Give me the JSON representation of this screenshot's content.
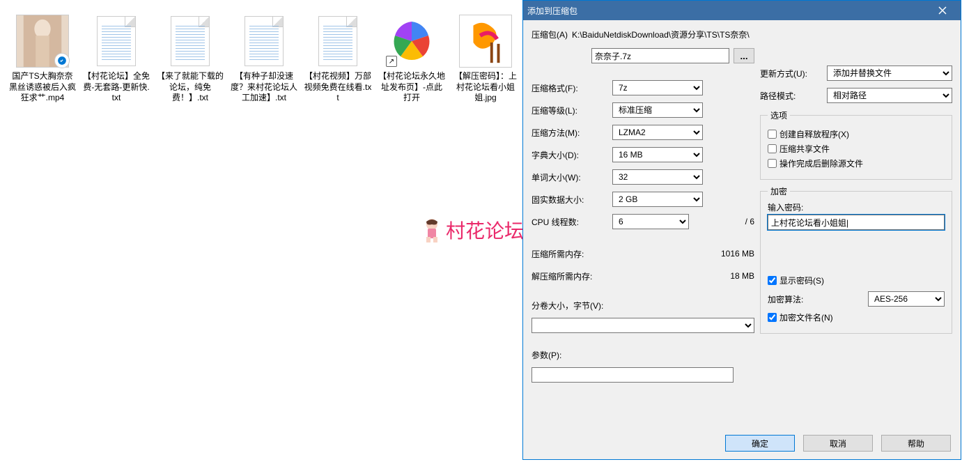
{
  "files": [
    {
      "label": "国产TS大胸奈奈黑丝诱惑被后入疯狂求艹.mp4",
      "type": "img"
    },
    {
      "label": "【村花论坛】全免费-无套路-更新快.txt",
      "type": "doc"
    },
    {
      "label": "【来了就能下载的论坛，纯免费！】.txt",
      "type": "doc"
    },
    {
      "label": "【有种子却没速度？来村花论坛人工加速】.txt",
      "type": "doc"
    },
    {
      "label": "【村花视频】万部视频免费在线看.txt",
      "type": "doc"
    },
    {
      "label": "【村花论坛永久地址发布页】-点此打开",
      "type": "shortcut"
    },
    {
      "label": "【解压密码】：上村花论坛看小姐姐.jpg",
      "type": "img2"
    }
  ],
  "watermark_text": "村花论坛",
  "dialog": {
    "title": "添加到压缩包",
    "archive_label": "压缩包(A)",
    "archive_path": "K:\\BaiduNetdiskDownload\\资源分享\\TS\\TS奈奈\\",
    "archive_name": "奈奈子.7z",
    "format_label": "压缩格式(F):",
    "format_value": "7z",
    "level_label": "压缩等级(L):",
    "level_value": "标准压缩",
    "method_label": "压缩方法(M):",
    "method_value": "LZMA2",
    "dict_label": "字典大小(D):",
    "dict_value": "16 MB",
    "word_label": "单词大小(W):",
    "word_value": "32",
    "solid_label": "固实数据大小:",
    "solid_value": "2 GB",
    "threads_label": "CPU 线程数:",
    "threads_value": "6",
    "threads_max": "/ 6",
    "mem_comp_label": "压缩所需内存:",
    "mem_comp_value": "1016 MB",
    "mem_decomp_label": "解压缩所需内存:",
    "mem_decomp_value": "18 MB",
    "split_label": "分卷大小，字节(V):",
    "params_label": "参数(P):",
    "update_label": "更新方式(U):",
    "update_value": "添加并替换文件",
    "pathmode_label": "路径模式:",
    "pathmode_value": "相对路径",
    "options_legend": "选项",
    "opt_sfx": "创建自释放程序(X)",
    "opt_share": "压缩共享文件",
    "opt_delete": "操作完成后删除源文件",
    "encrypt_legend": "加密",
    "pwd_label": "输入密码:",
    "pwd_value": "上村花论坛看小姐姐|",
    "show_pwd": "显示密码(S)",
    "enc_method_label": "加密算法:",
    "enc_method_value": "AES-256",
    "enc_names": "加密文件名(N)",
    "btn_ok": "确定",
    "btn_cancel": "取消",
    "btn_help": "帮助",
    "browse_btn": "..."
  }
}
